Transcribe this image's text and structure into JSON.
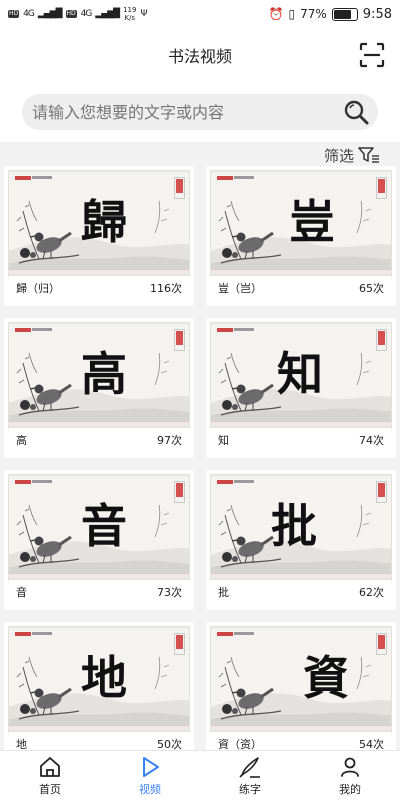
{
  "status_bar": {
    "sim1": "HD",
    "sim2": "HD",
    "signal1": "4G",
    "signal2": "4G",
    "speed_value": "119",
    "speed_unit": "K/s",
    "battery_percent": "77%",
    "battery_level": 0.77,
    "time": "9:58"
  },
  "header": {
    "title": "书法视频",
    "scan_icon": "scan-icon"
  },
  "search": {
    "placeholder": "请输入您想要的文字或内容",
    "icon": "search-icon"
  },
  "filter": {
    "label": "筛选",
    "icon": "filter-icon"
  },
  "videos": [
    {
      "char": "歸",
      "name": "歸（归）",
      "count": "116次"
    },
    {
      "char": "豈",
      "name": "豈（岂）",
      "count": "65次"
    },
    {
      "char": "高",
      "name": "高",
      "count": "97次"
    },
    {
      "char": "知",
      "name": "知",
      "count": "74次"
    },
    {
      "char": "音",
      "name": "音",
      "count": "73次"
    },
    {
      "char": "批",
      "name": "批",
      "count": "62次"
    },
    {
      "char": "地",
      "name": "地",
      "count": "50次"
    },
    {
      "char": "資",
      "name": "資（资）",
      "count": "54次"
    }
  ],
  "tabs": [
    {
      "label": "首页",
      "icon": "home-icon"
    },
    {
      "label": "视频",
      "icon": "play-icon",
      "active": true
    },
    {
      "label": "练字",
      "icon": "pen-icon"
    },
    {
      "label": "我的",
      "icon": "user-icon"
    }
  ],
  "colors": {
    "accent": "#3b82f6",
    "background": "#f2f2f2"
  }
}
